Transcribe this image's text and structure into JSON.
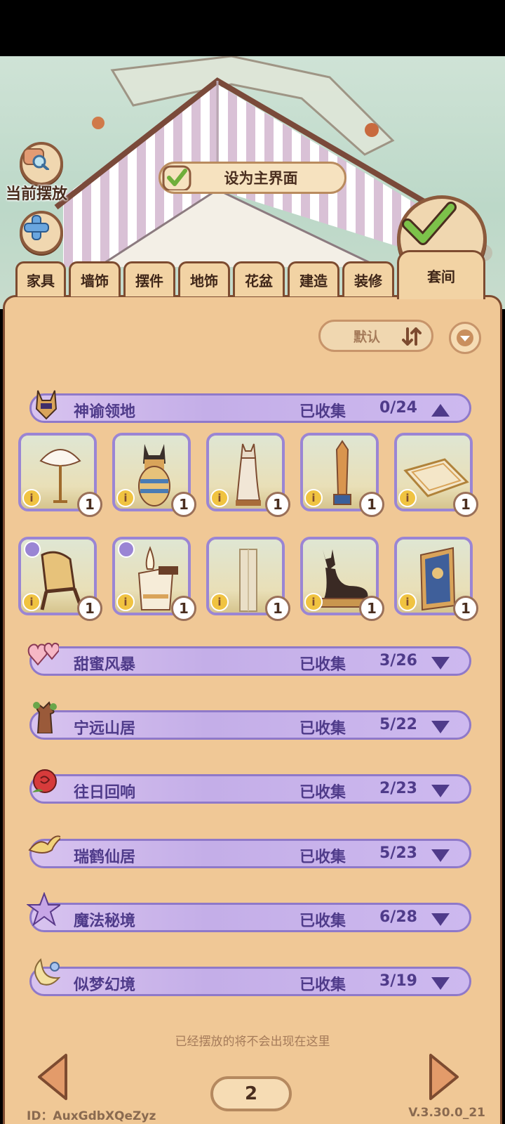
{
  "scene": {
    "placed_label": "当前摆放",
    "set_main_label": "设为主界面"
  },
  "tabs": [
    {
      "label": "家具"
    },
    {
      "label": "墙饰"
    },
    {
      "label": "摆件"
    },
    {
      "label": "地饰"
    },
    {
      "label": "花盆"
    },
    {
      "label": "建造"
    },
    {
      "label": "装修"
    },
    {
      "label": "套间"
    }
  ],
  "sort": {
    "label": "默认"
  },
  "suites": [
    {
      "name": "神谕领地",
      "collected_label": "已收集",
      "count": "0/24",
      "expanded": true,
      "icon": "anubis-mask-icon"
    },
    {
      "name": "甜蜜风暴",
      "collected_label": "已收集",
      "count": "3/26",
      "expanded": false,
      "icon": "hearts-icon"
    },
    {
      "name": "宁远山居",
      "collected_label": "已收集",
      "count": "5/22",
      "expanded": false,
      "icon": "tree-stump-icon"
    },
    {
      "name": "往日回响",
      "collected_label": "已收集",
      "count": "2/23",
      "expanded": false,
      "icon": "rose-icon"
    },
    {
      "name": "瑞鹤仙居",
      "collected_label": "已收集",
      "count": "5/23",
      "expanded": false,
      "icon": "crane-icon"
    },
    {
      "name": "魔法秘境",
      "collected_label": "已收集",
      "count": "6/28",
      "expanded": false,
      "icon": "magic-star-icon"
    },
    {
      "name": "似梦幻境",
      "collected_label": "已收集",
      "count": "3/19",
      "expanded": false,
      "icon": "moon-icon"
    }
  ],
  "items": [
    {
      "icon": "feather-fan-icon",
      "qty": "1",
      "badge": false
    },
    {
      "icon": "canopic-jar-icon",
      "qty": "1",
      "badge": false
    },
    {
      "icon": "cat-statue-icon",
      "qty": "1",
      "badge": false
    },
    {
      "icon": "obelisk-icon",
      "qty": "1",
      "badge": false
    },
    {
      "icon": "rug-icon",
      "qty": "1",
      "badge": false
    },
    {
      "icon": "egyptian-chair-icon",
      "qty": "1",
      "badge": true
    },
    {
      "icon": "altar-lamp-icon",
      "qty": "1",
      "badge": true
    },
    {
      "icon": "stone-pillar-icon",
      "qty": "1",
      "badge": false
    },
    {
      "icon": "anubis-statue-icon",
      "qty": "1",
      "badge": false
    },
    {
      "icon": "wall-tapestry-icon",
      "qty": "1",
      "badge": false
    }
  ],
  "info_glyph": "i",
  "footer": {
    "hint": "已经摆放的将不会出现在这里",
    "page": "2",
    "uid": "ID：AuxGdbXQeZyz",
    "version": "V.3.30.0_21"
  },
  "colors": {
    "panel": "#f0c896",
    "suite_bar": "#c4aee8",
    "suite_text": "#4f3b8a",
    "border_brown": "#7d4b30",
    "check_green": "#6fae3a"
  }
}
